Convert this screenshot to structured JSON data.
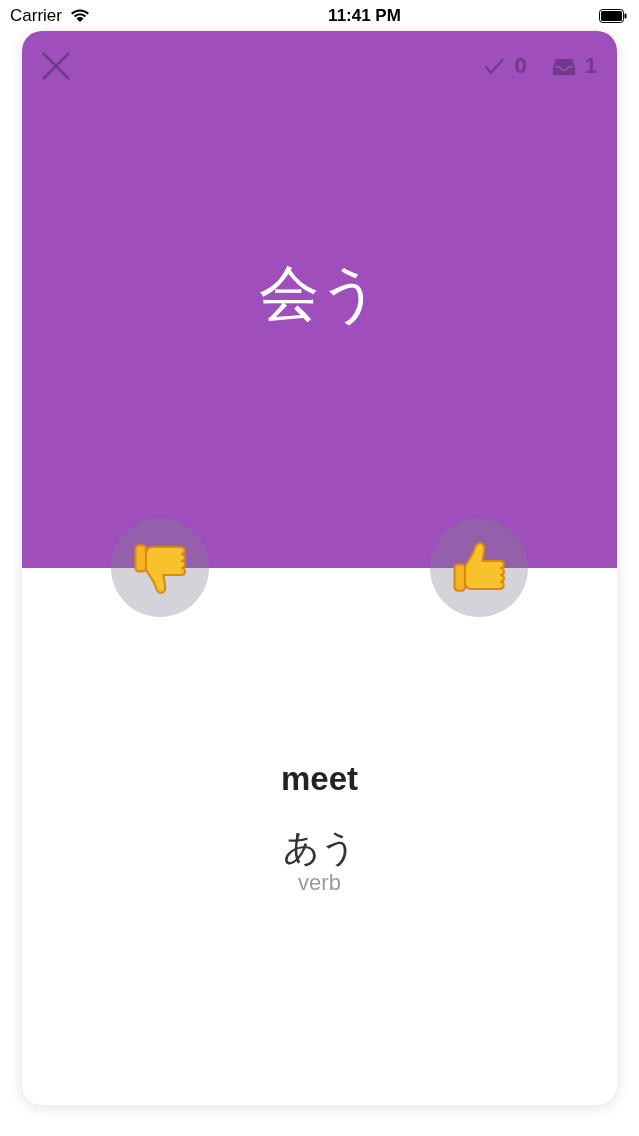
{
  "status_bar": {
    "carrier": "Carrier",
    "time": "11:41 PM"
  },
  "card": {
    "counts": [
      {
        "kind": "done",
        "value": "0"
      },
      {
        "kind": "inbox",
        "value": "1"
      }
    ],
    "term": "会う",
    "answer_buttons": [
      {
        "kind": "down"
      },
      {
        "kind": "up"
      }
    ],
    "meaning": "meet",
    "reading": "あう",
    "part_of_speech": "verb"
  }
}
